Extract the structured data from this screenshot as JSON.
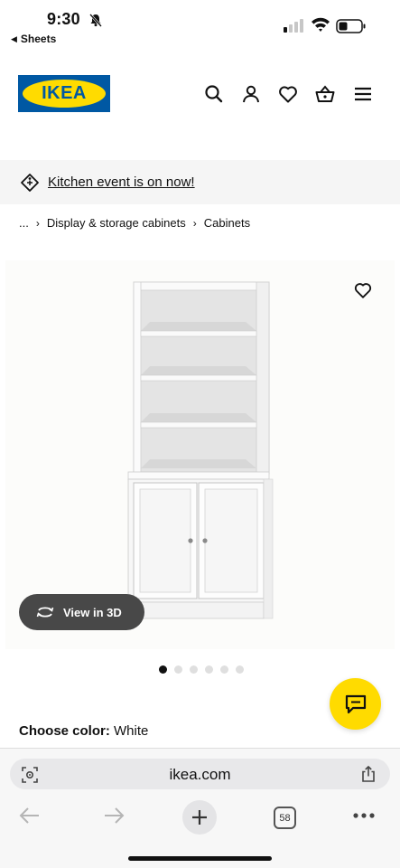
{
  "status": {
    "time": "9:30",
    "back_app": "Sheets"
  },
  "header": {
    "logo_text": "IKEA"
  },
  "banner": {
    "text": "Kitchen event is on now!"
  },
  "breadcrumb": {
    "ellipsis": "...",
    "items": [
      "Display & storage cabinets",
      "Cabinets"
    ]
  },
  "product": {
    "view3d_label": "View in 3D",
    "image_count": 6,
    "active_image": 1
  },
  "color": {
    "label": "Choose color:",
    "value": "White"
  },
  "browser": {
    "url": "ikea.com",
    "tab_count": "58"
  },
  "colors": {
    "brand_blue": "#0058a3",
    "brand_yellow": "#ffdb00"
  }
}
